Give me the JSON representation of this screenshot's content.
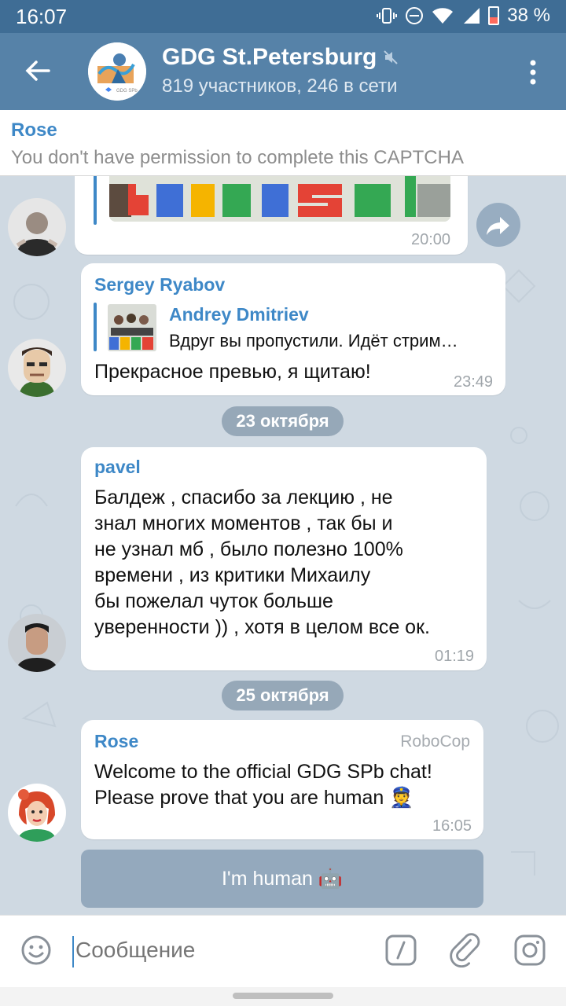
{
  "status_bar": {
    "time": "16:07",
    "battery": "38 %",
    "battery_level": 0.38
  },
  "header": {
    "title": "GDG St.Petersburg",
    "subtitle": "819 участников, 246 в сети",
    "back_icon": "arrow-left-icon",
    "mute_icon": "muted-speaker-icon",
    "menu_icon": "more-vertical-icon",
    "accent": "#5682a8"
  },
  "pinned": {
    "name": "Rose",
    "text": "You don't have permission to complete this CAPTCHA"
  },
  "messages": [
    {
      "id": "m1",
      "time": "20:00"
    },
    {
      "id": "m2",
      "sender": "Sergey Ryabov",
      "sender_color": "#3e88c7",
      "reply": {
        "name": "Andrey Dmitriev",
        "text": "Вдруг вы пропустили. Идёт стрим…"
      },
      "text": "Прекрасное превью, я щитаю!",
      "time": "23:49"
    },
    {
      "id": "m3",
      "sender": "pavel",
      "sender_color": "#3e88c7",
      "lines": [
        "Балдеж , спасибо за лекцию , не",
        "знал многих моментов , так бы и",
        "не узнал мб , было полезно 100%",
        "времени , из критики Михаилу",
        "бы пожелал чуток больше",
        "уверенности )) , хотя в целом все ок."
      ],
      "time": "01:19"
    },
    {
      "id": "m4",
      "sender": "Rose",
      "sender_color": "#3e88c7",
      "badge": "RoboCop",
      "lines": [
        "Welcome to the official GDG SPb chat!",
        "Please prove that you are human 👮"
      ],
      "time": "16:05"
    }
  ],
  "dates": [
    "23 октября",
    "25 октября"
  ],
  "inline_button": "I'm human 🤖",
  "composer": {
    "placeholder": "Сообщение"
  }
}
